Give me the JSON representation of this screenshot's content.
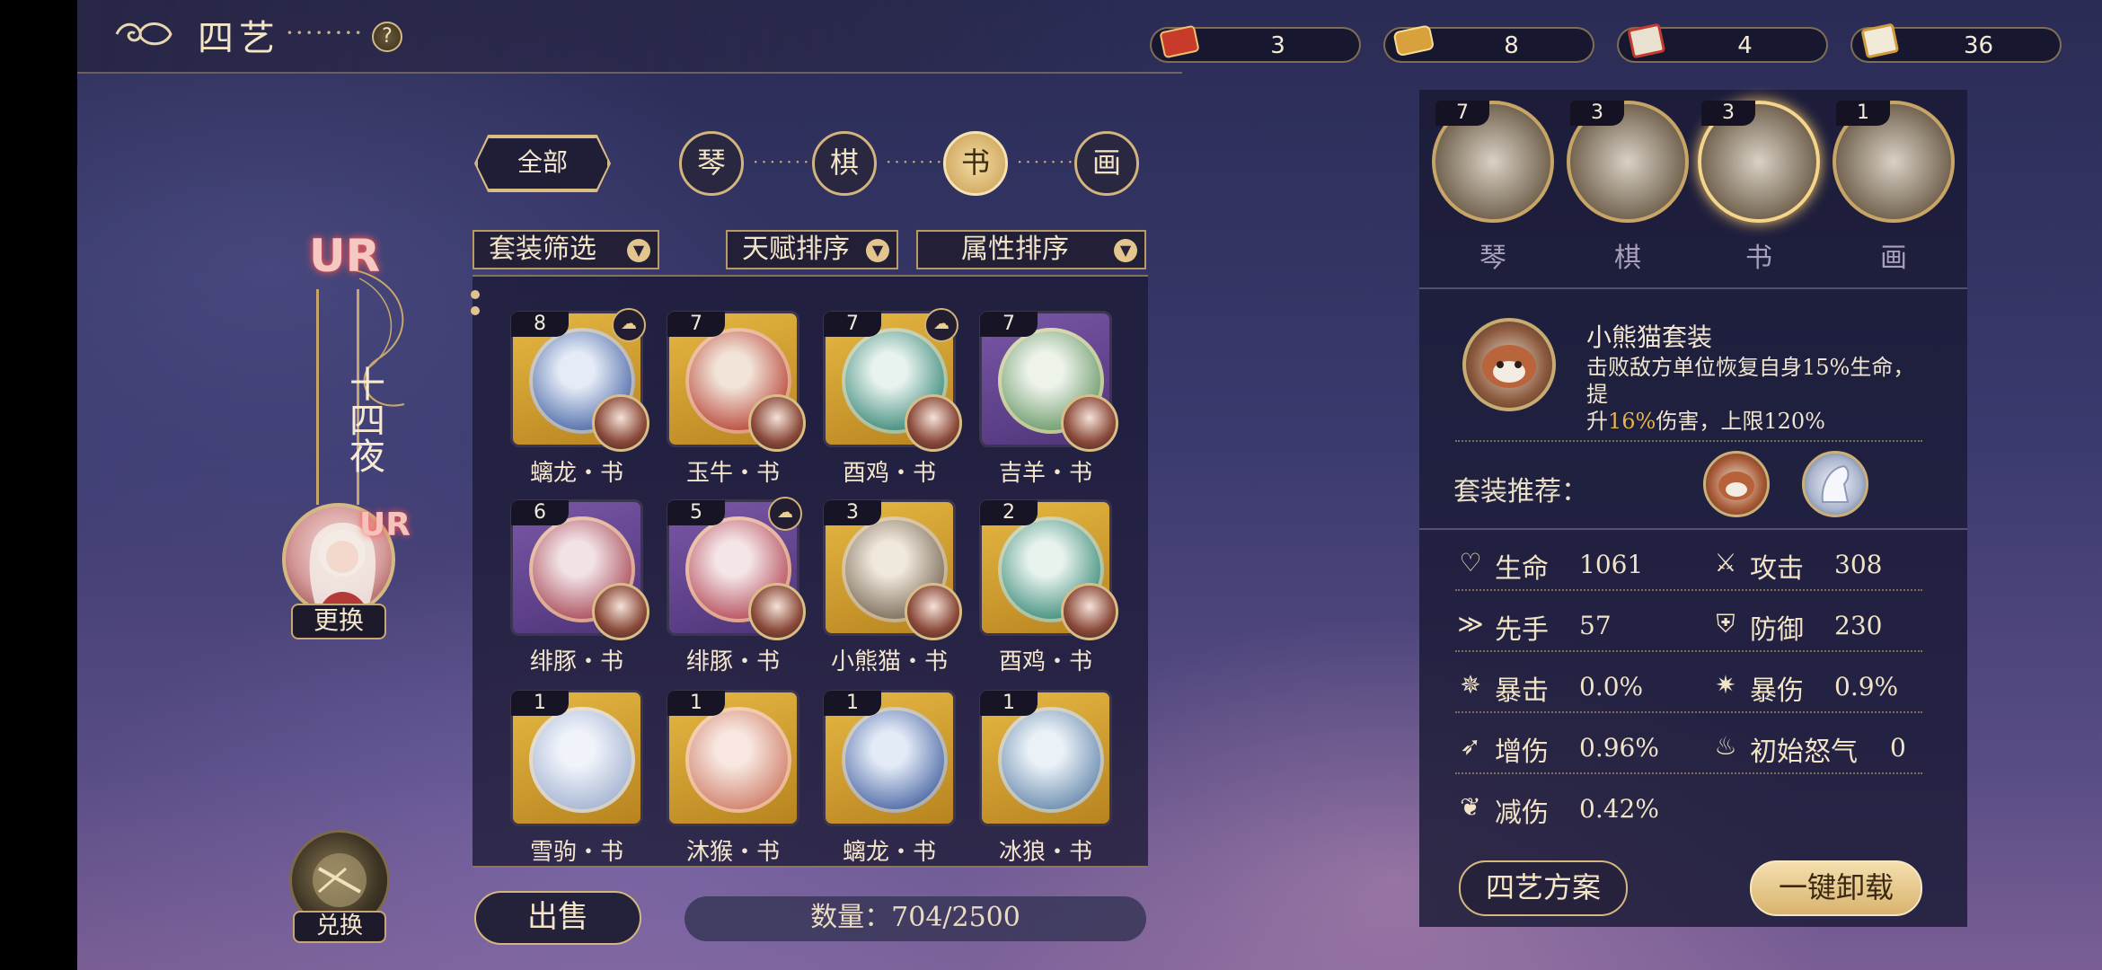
{
  "header": {
    "title": "四艺",
    "dots": "········",
    "help": "?"
  },
  "currencies": [
    {
      "icon": "scroll-red-icon",
      "value": "3"
    },
    {
      "icon": "scroll-gold-icon",
      "value": "8"
    },
    {
      "icon": "scroll-book-icon",
      "value": "4"
    },
    {
      "icon": "scroll-painting-icon",
      "value": "36"
    }
  ],
  "character": {
    "rarity": "UR",
    "name": "十四夜",
    "swap_label": "更换",
    "exchange_label": "兑换"
  },
  "tabs": {
    "all": "全部",
    "categories": [
      {
        "label": "琴",
        "active": false
      },
      {
        "label": "棋",
        "active": false
      },
      {
        "label": "书",
        "active": true
      },
      {
        "label": "画",
        "active": false
      }
    ]
  },
  "filters": {
    "set_filter": "套装筛选",
    "talent_sort": "天赋排序",
    "attr_sort": "属性排序"
  },
  "items": [
    {
      "count": "8",
      "label": "螭龙・书",
      "bg": "gold",
      "set_icon": true
    },
    {
      "count": "7",
      "label": "玉牛・书",
      "bg": "gold",
      "set_icon": false
    },
    {
      "count": "7",
      "label": "酉鸡・书",
      "bg": "gold",
      "set_icon": true
    },
    {
      "count": "7",
      "label": "吉羊・书",
      "bg": "purple",
      "set_icon": false
    },
    {
      "count": "6",
      "label": "绯豚・书",
      "bg": "purple",
      "set_icon": false
    },
    {
      "count": "5",
      "label": "绯豚・书",
      "bg": "purple",
      "set_icon": true
    },
    {
      "count": "3",
      "label": "小熊猫・书",
      "bg": "gold",
      "set_icon": false
    },
    {
      "count": "2",
      "label": "酉鸡・书",
      "bg": "gold",
      "set_icon": false
    },
    {
      "count": "1",
      "label": "雪驹・书",
      "bg": "gold",
      "set_icon": false
    },
    {
      "count": "1",
      "label": "沐猴・书",
      "bg": "gold",
      "set_icon": false
    },
    {
      "count": "1",
      "label": "螭龙・书",
      "bg": "gold",
      "set_icon": false
    },
    {
      "count": "1",
      "label": "冰狼・书",
      "bg": "gold",
      "set_icon": false
    }
  ],
  "bottom": {
    "sell_label": "出售",
    "quantity": "数量：704/2500"
  },
  "equipped": [
    {
      "count": "7",
      "label": "琴",
      "active": false
    },
    {
      "count": "3",
      "label": "棋",
      "active": false
    },
    {
      "count": "3",
      "label": "书",
      "active": true
    },
    {
      "count": "1",
      "label": "画",
      "active": false
    }
  ],
  "set": {
    "name": "小熊猫套装",
    "desc_1": "击败敌方单位恢复自身15%生命，提",
    "desc_2a": "升",
    "desc_2b": "16%",
    "desc_2c": "伤害，上限120%",
    "recommend_label": "套装推荐："
  },
  "stats": [
    {
      "icon": "heart-icon",
      "label": "生命",
      "value": "1061"
    },
    {
      "icon": "sword-icon",
      "label": "攻击",
      "value": "308"
    },
    {
      "icon": "speed-icon",
      "label": "先手",
      "value": "57"
    },
    {
      "icon": "shield-icon",
      "label": "防御",
      "value": "230"
    },
    {
      "icon": "crit-icon",
      "label": "暴击",
      "value": "0.0%"
    },
    {
      "icon": "crit-dmg-icon",
      "label": "暴伤",
      "value": "0.9%"
    },
    {
      "icon": "dmg-up-icon",
      "label": "增伤",
      "value": "0.96%"
    },
    {
      "icon": "rage-icon",
      "label": "初始怒气",
      "value": "0"
    },
    {
      "icon": "dmg-down-icon",
      "label": "减伤",
      "value": "0.42%"
    }
  ],
  "actions": {
    "plan_label": "四艺方案",
    "unload_label": "一键卸载"
  }
}
